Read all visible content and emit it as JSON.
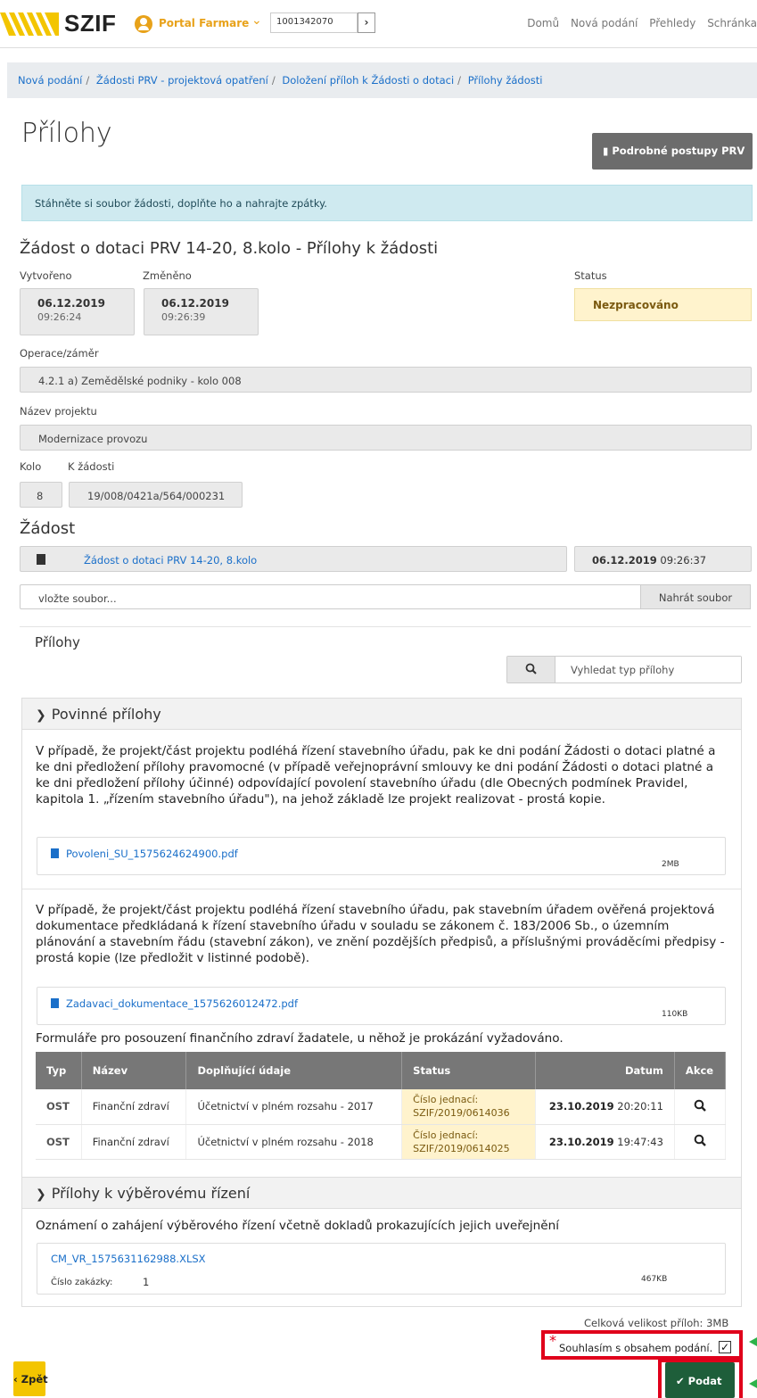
{
  "header": {
    "logo_text": "SZIF",
    "portal_label": "Portal Farmare",
    "client_id": "1001342070",
    "nav": [
      "Domů",
      "Nová podání",
      "Přehledy",
      "Schránka"
    ]
  },
  "breadcrumb": [
    "Nová podání",
    "Žádosti PRV - projektová opatření",
    "Doložení příloh k Žádosti o dotaci",
    "Přílohy žádosti"
  ],
  "page": {
    "title": "Přílohy",
    "prv_button": "Podrobné postupy PRV",
    "info": "Stáhněte si soubor žádosti, doplňte ho a nahrajte zpátky."
  },
  "detail": {
    "title": "Žádost o dotaci PRV 14-20, 8.kolo - Přílohy k žádosti",
    "created_label": "Vytvořeno",
    "created_date": "06.12.2019",
    "created_time": "09:26:24",
    "changed_label": "Změněno",
    "changed_date": "06.12.2019",
    "changed_time": "09:26:39",
    "status_label": "Status",
    "status_value": "Nezpracováno",
    "operation_label": "Operace/záměr",
    "operation_value": "4.2.1 a) Zemědělské podniky - kolo 008",
    "project_label": "Název projektu",
    "project_value": "Modernizace provozu",
    "round_label": "Kolo",
    "round_value": "8",
    "ref_label": "K žádosti",
    "ref_value": "19/008/0421a/564/000231"
  },
  "zadost": {
    "title": "Žádost",
    "file_link": "Žádost o dotaci PRV 14-20, 8.kolo",
    "file_date": "06.12.2019",
    "file_time": "09:26:37",
    "upload_placeholder": "vložte soubor...",
    "upload_button": "Nahrát soubor"
  },
  "prilohy": {
    "title": "Přílohy",
    "search_placeholder": "Vyhledat typ přílohy"
  },
  "povinne": {
    "header": "Povinné přílohy",
    "item1_text": "V případě, že projekt/část projektu podléhá řízení stavebního úřadu, pak ke dni podání Žádosti o dotaci platné a ke dni předložení přílohy pravomocné (v případě veřejnoprávní smlouvy ke dni podání Žádosti o dotaci platné a ke dni předložení přílohy účinné) odpovídající povolení stavebního úřadu (dle Obecných podmínek Pravidel, kapitola 1. „řízením stavebního úřadu\"), na jehož základě lze projekt realizovat - prostá kopie.",
    "item1_file": "Povoleni_SU_1575624624900.pdf",
    "item1_size": "2MB",
    "item2_text": "V případě, že projekt/část projektu podléhá řízení stavebního úřadu, pak stavebním úřadem ověřená projektová dokumentace předkládaná k řízení stavebního úřadu v souladu se zákonem č. 183/2006 Sb., o územním plánování a stavebním řádu (stavební zákon), ve znění pozdějších předpisů, a příslušnými prováděcími předpisy - prostá kopie (lze předložit v listinné podobě).",
    "item2_file": "Zadavaci_dokumentace_1575626012472.pdf",
    "item2_size": "110KB",
    "item3_text": "Formuláře pro posouzení finančního zdraví žadatele, u něhož je prokázání vyžadováno.",
    "table_headers": [
      "Typ",
      "Název",
      "Doplňující údaje",
      "Status",
      "Datum",
      "Akce"
    ],
    "rows": [
      {
        "typ": "OST",
        "nazev": "Finanční zdraví",
        "udaje": "Účetnictví v plném rozsahu - 2017",
        "status1": "Číslo jednací:",
        "status2": "SZIF/2019/0614036",
        "datum": "23.10.2019",
        "cas": "20:20:11"
      },
      {
        "typ": "OST",
        "nazev": "Finanční zdraví",
        "udaje": "Účetnictví v plném rozsahu - 2018",
        "status1": "Číslo jednací:",
        "status2": "SZIF/2019/0614025",
        "datum": "23.10.2019",
        "cas": "19:47:43"
      }
    ]
  },
  "vyber": {
    "header": "Přílohy k výběrovému řízení",
    "text": "Oznámení o zahájení výběrového řízení včetně dokladů prokazujících jejich uveřejnění",
    "file": "CM_VR_1575631162988.XLSX",
    "size": "467KB",
    "order_label": "Číslo zakázky:",
    "order_value": "1"
  },
  "footer": {
    "total_size": "Celková velikost příloh: 3MB",
    "consent_star": "*",
    "consent_text": "Souhlasím s obsahem podání.",
    "back_button": "Zpět",
    "submit_button": "Podat"
  },
  "colors": {
    "accent_orange": "#e8a21a",
    "link_blue": "#1a6fc9",
    "highlight_red": "#e0001b",
    "submit_green": "#1e5e3a",
    "back_yellow": "#f3c500"
  }
}
